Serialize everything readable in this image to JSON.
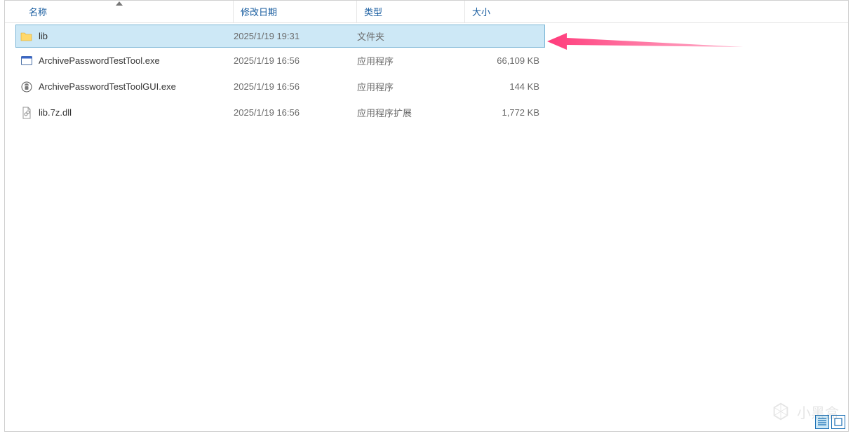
{
  "columns": {
    "name": "名称",
    "date": "修改日期",
    "type": "类型",
    "size": "大小",
    "sorted": "name",
    "sort_dir": "asc"
  },
  "rows": [
    {
      "icon": "folder-icon",
      "name": "lib",
      "date": "2025/1/19 19:31",
      "type": "文件夹",
      "size": "",
      "selected": true
    },
    {
      "icon": "exe-icon",
      "name": "ArchivePasswordTestTool.exe",
      "date": "2025/1/19 16:56",
      "type": "应用程序",
      "size": "66,109 KB",
      "selected": false
    },
    {
      "icon": "exe-gui-icon",
      "name": "ArchivePasswordTestToolGUI.exe",
      "date": "2025/1/19 16:56",
      "type": "应用程序",
      "size": "144 KB",
      "selected": false
    },
    {
      "icon": "dll-icon",
      "name": "lib.7z.dll",
      "date": "2025/1/19 16:56",
      "type": "应用程序扩展",
      "size": "1,772 KB",
      "selected": false
    }
  ],
  "watermark": {
    "text": "小黑盒"
  },
  "annotation": {
    "arrow_color": "#ff3b7b"
  },
  "view": {
    "active": "details"
  }
}
